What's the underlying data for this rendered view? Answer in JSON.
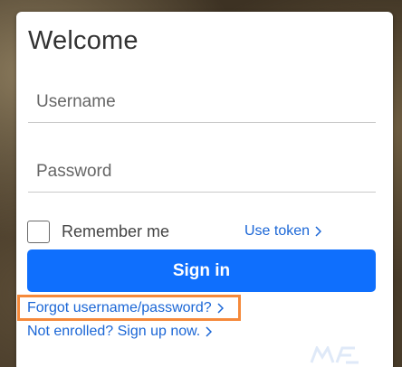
{
  "login": {
    "title": "Welcome",
    "username_placeholder": "Username",
    "password_placeholder": "Password",
    "remember_label": "Remember me",
    "remember_checked": false,
    "use_token_label": "Use token",
    "signin_label": "Sign in",
    "forgot_label": "Forgot username/password?",
    "enroll_label": "Not enrolled? Sign up now."
  },
  "colors": {
    "primary_button": "#0f6ffd",
    "link": "#1a66d6",
    "highlight_box": "#f5893a"
  },
  "icons": {
    "chevron": "chevron-right-icon"
  }
}
